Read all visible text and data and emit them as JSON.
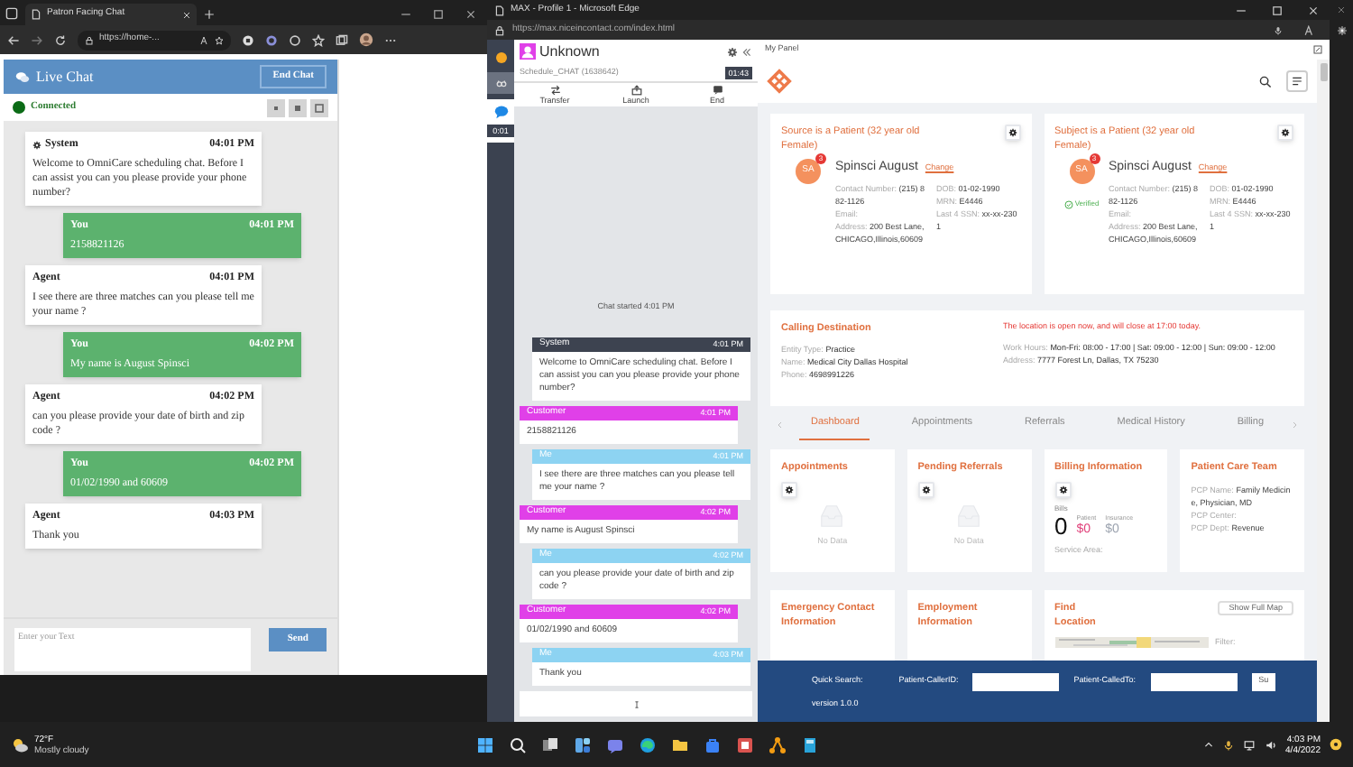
{
  "left_browser": {
    "tab_title": "Patron Facing Chat",
    "address": "https://home-...",
    "live_chat": {
      "title": "Live Chat",
      "end_button": "End Chat",
      "status": "Connected",
      "messages": [
        {
          "kind": "system",
          "sender": "System",
          "time": "04:01 PM",
          "text": "Welcome to OmniCare scheduling chat. Before I can assist you can you please provide your phone number?"
        },
        {
          "kind": "you",
          "sender": "You",
          "time": "04:01 PM",
          "text": "2158821126"
        },
        {
          "kind": "agent",
          "sender": "Agent",
          "time": "04:01 PM",
          "text": "I see there are three matches can you please tell me your name ?"
        },
        {
          "kind": "you",
          "sender": "You",
          "time": "04:02 PM",
          "text": "My name is August Spinsci"
        },
        {
          "kind": "agent",
          "sender": "Agent",
          "time": "04:02 PM",
          "text": "can you please provide your date of birth and zip code ?"
        },
        {
          "kind": "you",
          "sender": "You",
          "time": "04:02 PM",
          "text": "01/02/1990 and 60609"
        },
        {
          "kind": "agent",
          "sender": "Agent",
          "time": "04:03 PM",
          "text": "Thank you"
        }
      ],
      "input": {
        "placeholder": "Enter your Text"
      },
      "send_button": "Send"
    }
  },
  "right_browser": {
    "title": "MAX - Profile 1 - Microsoft Edge",
    "address": "https://max.niceincontact.com/index.html"
  },
  "max": {
    "timer": "0:01",
    "contact": "Unknown",
    "skill": "Schedule_CHAT (1638642)",
    "elapsed": "01:43",
    "actions": [
      {
        "kind": "transfer",
        "label": "Transfer"
      },
      {
        "kind": "launch",
        "label": "Launch"
      },
      {
        "kind": "end",
        "label": "End"
      }
    ],
    "chat_started": "Chat started 4:01 PM",
    "messages": [
      {
        "kind": "system",
        "sender": "System",
        "time": "4:01 PM",
        "text": "Welcome to OmniCare scheduling chat. Before I can assist you can you please provide your phone number?"
      },
      {
        "kind": "customer",
        "sender": "Customer",
        "time": "4:01 PM",
        "text": "2158821126"
      },
      {
        "kind": "me",
        "sender": "Me",
        "time": "4:01 PM",
        "text": "I see there are three matches can you please tell me your name ?"
      },
      {
        "kind": "customer",
        "sender": "Customer",
        "time": "4:02 PM",
        "text": "My name is August Spinsci"
      },
      {
        "kind": "me",
        "sender": "Me",
        "time": "4:02 PM",
        "text": "can you please provide your date of birth and zip code ?"
      },
      {
        "kind": "customer",
        "sender": "Customer",
        "time": "4:02 PM",
        "text": "01/02/1990 and 60609"
      },
      {
        "kind": "me",
        "sender": "Me",
        "time": "4:03 PM",
        "text": "Thank you"
      }
    ]
  },
  "my_panel": {
    "title": "My Panel",
    "patients": [
      {
        "heading": "Source is a Patient (32 year old Female)",
        "initials": "SA",
        "badge": "3",
        "name": "Spinsci August",
        "change": "Change",
        "fields_left": [
          {
            "label": "Contact Number:",
            "value": "(215) 882-1126"
          },
          {
            "label": "Email:"
          },
          {
            "label": "Address:",
            "value": "200 Best Lane,CHICAGO,Illinois,60609"
          }
        ],
        "fields_right": [
          {
            "label": "DOB:",
            "value": "01-02-1990"
          },
          {
            "label": "MRN:",
            "value": "E4446"
          },
          {
            "label": "Last 4 SSN:",
            "value": "xx-xx-2301"
          }
        ]
      },
      {
        "heading": "Subject is a Patient (32 year old Female)",
        "initials": "SA",
        "badge": "3",
        "name": "Spinsci August",
        "change": "Change",
        "verified_label": "Verified",
        "fields_left": [
          {
            "label": "Contact Number:",
            "value": "(215) 882-1126"
          },
          {
            "label": "Email:"
          },
          {
            "label": "Address:",
            "value": "200 Best Lane,CHICAGO,Illinois,60609"
          }
        ],
        "fields_right": [
          {
            "label": "DOB:",
            "value": "01-02-1990"
          },
          {
            "label": "MRN:",
            "value": "E4446"
          },
          {
            "label": "Last 4 SSN:",
            "value": "xx-xx-2301"
          }
        ]
      }
    ],
    "calling": {
      "title": "Calling Destination",
      "notice": "The location is open now, and will close at 17:00 today.",
      "fields_left": [
        {
          "label": "Entity Type:",
          "value": "Practice"
        },
        {
          "label": "Name:",
          "value": "Medical City Dallas Hospital"
        },
        {
          "label": "Phone:",
          "value": "4698991226"
        }
      ],
      "fields_right": [
        {
          "label": "Work Hours:",
          "value": "Mon-Fri: 08:00 - 17:00 | Sat: 09:00 - 12:00 | Sun: 09:00 - 12:00"
        },
        {
          "label": "Address:",
          "value": "7777 Forest Ln, Dallas, TX 75230"
        }
      ]
    },
    "tabs": [
      {
        "label": "Dashboard",
        "selected": true
      },
      {
        "label": "Appointments",
        "selected": false
      },
      {
        "label": "Referrals",
        "selected": false
      },
      {
        "label": "Medical History",
        "selected": false
      },
      {
        "label": "Billing",
        "selected": false
      }
    ],
    "cards": [
      {
        "kind": "empty",
        "title": "Appointments",
        "empty_text": "No Data"
      },
      {
        "kind": "empty",
        "title": "Pending Referrals",
        "empty_text": "No Data"
      },
      {
        "kind": "billing",
        "title": "Billing Information",
        "bills_label": "Bills",
        "bills_value": "0",
        "amounts": [
          {
            "label": "Patient",
            "value": "$0",
            "color": "#e0407a"
          },
          {
            "label": "Insurance",
            "value": "$0",
            "color": "#9ca3af"
          }
        ],
        "service_area": "Service Area:"
      },
      {
        "kind": "fields",
        "title": "Patient Care Team",
        "fields": [
          {
            "label": "PCP Name:",
            "value": "Family Medicine, Physician, MD"
          },
          {
            "label": "PCP Center:"
          },
          {
            "label": "PCP Dept:",
            "value": "Revenue"
          }
        ]
      },
      {
        "kind": "title",
        "title": "Emergency Contact Information"
      },
      {
        "kind": "title",
        "title": "Employment Information"
      },
      {
        "kind": "map",
        "title": "Find Location",
        "button": "Show Full Map",
        "filter": "Filter:"
      }
    ],
    "quick_search": {
      "label": "Quick Search:",
      "fields": [
        {
          "label": "Patient-CallerID:"
        },
        {
          "label": "Patient-CalledTo:"
        }
      ],
      "button": "Su",
      "version": "version 1.0.0"
    }
  },
  "taskbar": {
    "temperature": "72°F",
    "weather": "Mostly cloudy",
    "time": "4:03 PM",
    "date": "4/4/2022"
  }
}
